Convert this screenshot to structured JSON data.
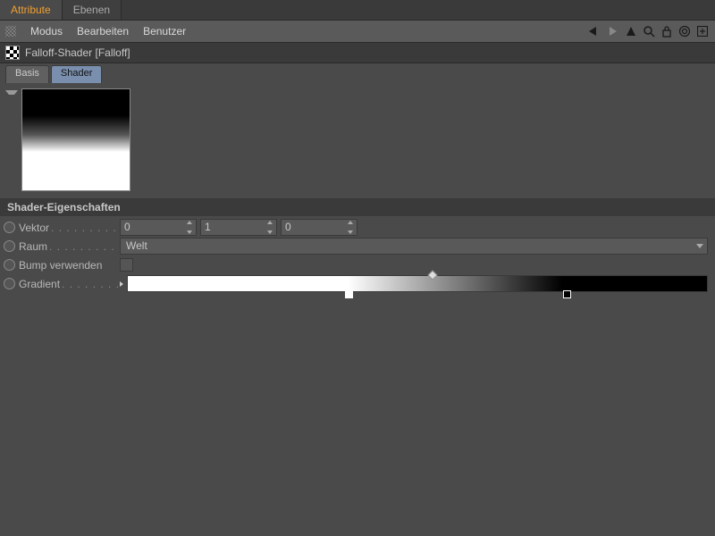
{
  "top_tabs": {
    "attribute": "Attribute",
    "ebenen": "Ebenen"
  },
  "menubar": {
    "modus": "Modus",
    "bearbeiten": "Bearbeiten",
    "benutzer": "Benutzer"
  },
  "breadcrumb": "Falloff-Shader [Falloff]",
  "subtabs": {
    "basis": "Basis",
    "shader": "Shader"
  },
  "section": "Shader-Eigenschaften",
  "props": {
    "vektor": {
      "label": "Vektor",
      "x": "0",
      "y": "1",
      "z": "0"
    },
    "raum": {
      "label": "Raum",
      "value": "Welt"
    },
    "bump": {
      "label": "Bump verwenden",
      "checked": false
    },
    "gradient": {
      "label": "Gradient"
    }
  },
  "dots": ". . . . . . . . . . . . . . . . . . . . . ."
}
